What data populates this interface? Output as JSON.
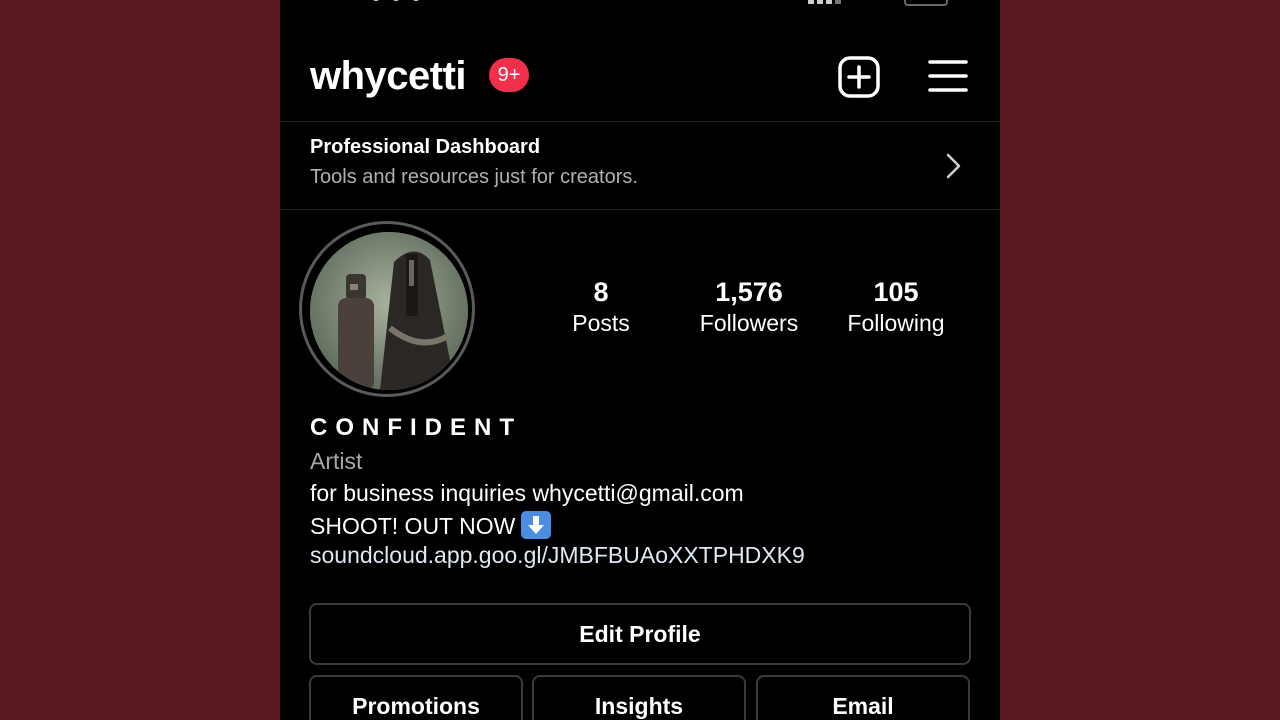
{
  "header": {
    "username": "whycetti",
    "notification_badge": "9+",
    "badge_color": "#f0304a",
    "add_icon": "plus-square-icon",
    "menu_icon": "hamburger-menu-icon"
  },
  "dashboard": {
    "title": "Professional Dashboard",
    "subtitle": "Tools and resources just for creators.",
    "chevron_icon": "chevron-right-icon"
  },
  "stats": [
    {
      "value": "8",
      "label": "Posts"
    },
    {
      "value": "1,576",
      "label": "Followers"
    },
    {
      "value": "105",
      "label": "Following"
    }
  ],
  "profile": {
    "display_name": "CONFIDENT",
    "category": "Artist",
    "bio_line1": "for business inquiries whycetti@gmail.com",
    "bio_line2": "SHOOT! OUT NOW",
    "bio_emoji_icon": "down-arrow-emoji-icon",
    "link": "soundcloud.app.goo.gl/JMBFBUAoXXTPHDXK9"
  },
  "buttons": {
    "edit_profile": "Edit Profile",
    "promotions": "Promotions",
    "insights": "Insights",
    "email": "Email"
  },
  "colors": {
    "background_outer": "#5a1a22",
    "app_background": "#000000",
    "muted_text": "#a8a8a8",
    "button_border": "#3a3a3a"
  }
}
